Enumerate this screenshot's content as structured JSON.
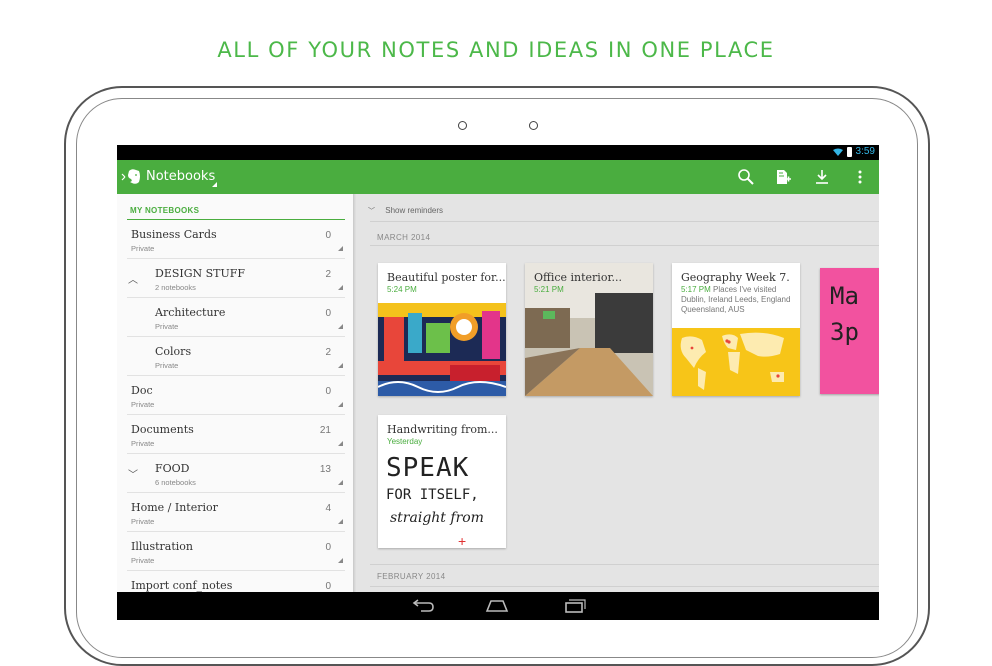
{
  "headline": "ALL OF YOUR NOTES AND IDEAS IN ONE PLACE",
  "status_bar": {
    "time": "3:59"
  },
  "action_bar": {
    "title": "Notebooks",
    "icons": [
      "evernote-logo-icon",
      "search-icon",
      "new-note-icon",
      "sync-icon",
      "overflow-menu-icon"
    ]
  },
  "sidebar": {
    "header": "MY NOTEBOOKS",
    "items": [
      {
        "name": "Business Cards",
        "sub": "Private",
        "count": "0",
        "stack": false,
        "indent": false
      },
      {
        "name": "DESIGN STUFF",
        "sub": "2 notebooks",
        "count": "2",
        "stack": true,
        "chevron": "up",
        "indent": false
      },
      {
        "name": "Architecture",
        "sub": "Private",
        "count": "0",
        "stack": false,
        "indent": true
      },
      {
        "name": "Colors",
        "sub": "Private",
        "count": "2",
        "stack": false,
        "indent": true
      },
      {
        "name": "Doc",
        "sub": "Private",
        "count": "0",
        "stack": false,
        "indent": false
      },
      {
        "name": "Documents",
        "sub": "Private",
        "count": "21",
        "stack": false,
        "indent": false
      },
      {
        "name": "FOOD",
        "sub": "6 notebooks",
        "count": "13",
        "stack": true,
        "chevron": "down",
        "indent": false
      },
      {
        "name": "Home / Interior",
        "sub": "Private",
        "count": "4",
        "stack": false,
        "indent": false
      },
      {
        "name": "Illustration",
        "sub": "Private",
        "count": "0",
        "stack": false,
        "indent": false
      },
      {
        "name": "Import conf_notes",
        "sub": "",
        "count": "0",
        "stack": false,
        "indent": false
      }
    ]
  },
  "main": {
    "reminders_label": "Show reminders",
    "sections": [
      {
        "month": "MARCH 2014"
      },
      {
        "month": "FEBRUARY 2014"
      }
    ],
    "notes": [
      {
        "title": "Beautiful poster for...",
        "time": "5:24 PM",
        "snippet": ""
      },
      {
        "title": "Office interior...",
        "time": "5:21 PM",
        "snippet": ""
      },
      {
        "title": "Geography Week 7.",
        "time": "5:17 PM",
        "snippet": "Places I've visited Dublin, Ireland Leeds, England Queensland, AUS"
      },
      {
        "title": "Handwriting from...",
        "time": "Yesterday",
        "snippet": ""
      }
    ],
    "handwriting_lines": [
      "SPEAK",
      "FOR ITSELF,",
      "straight from"
    ],
    "sticky_text": [
      "Ma",
      "3p"
    ]
  },
  "colors": {
    "brand_green": "#4aad3f",
    "headline_green": "#4cb849",
    "sticky_pink": "#f2529f"
  }
}
